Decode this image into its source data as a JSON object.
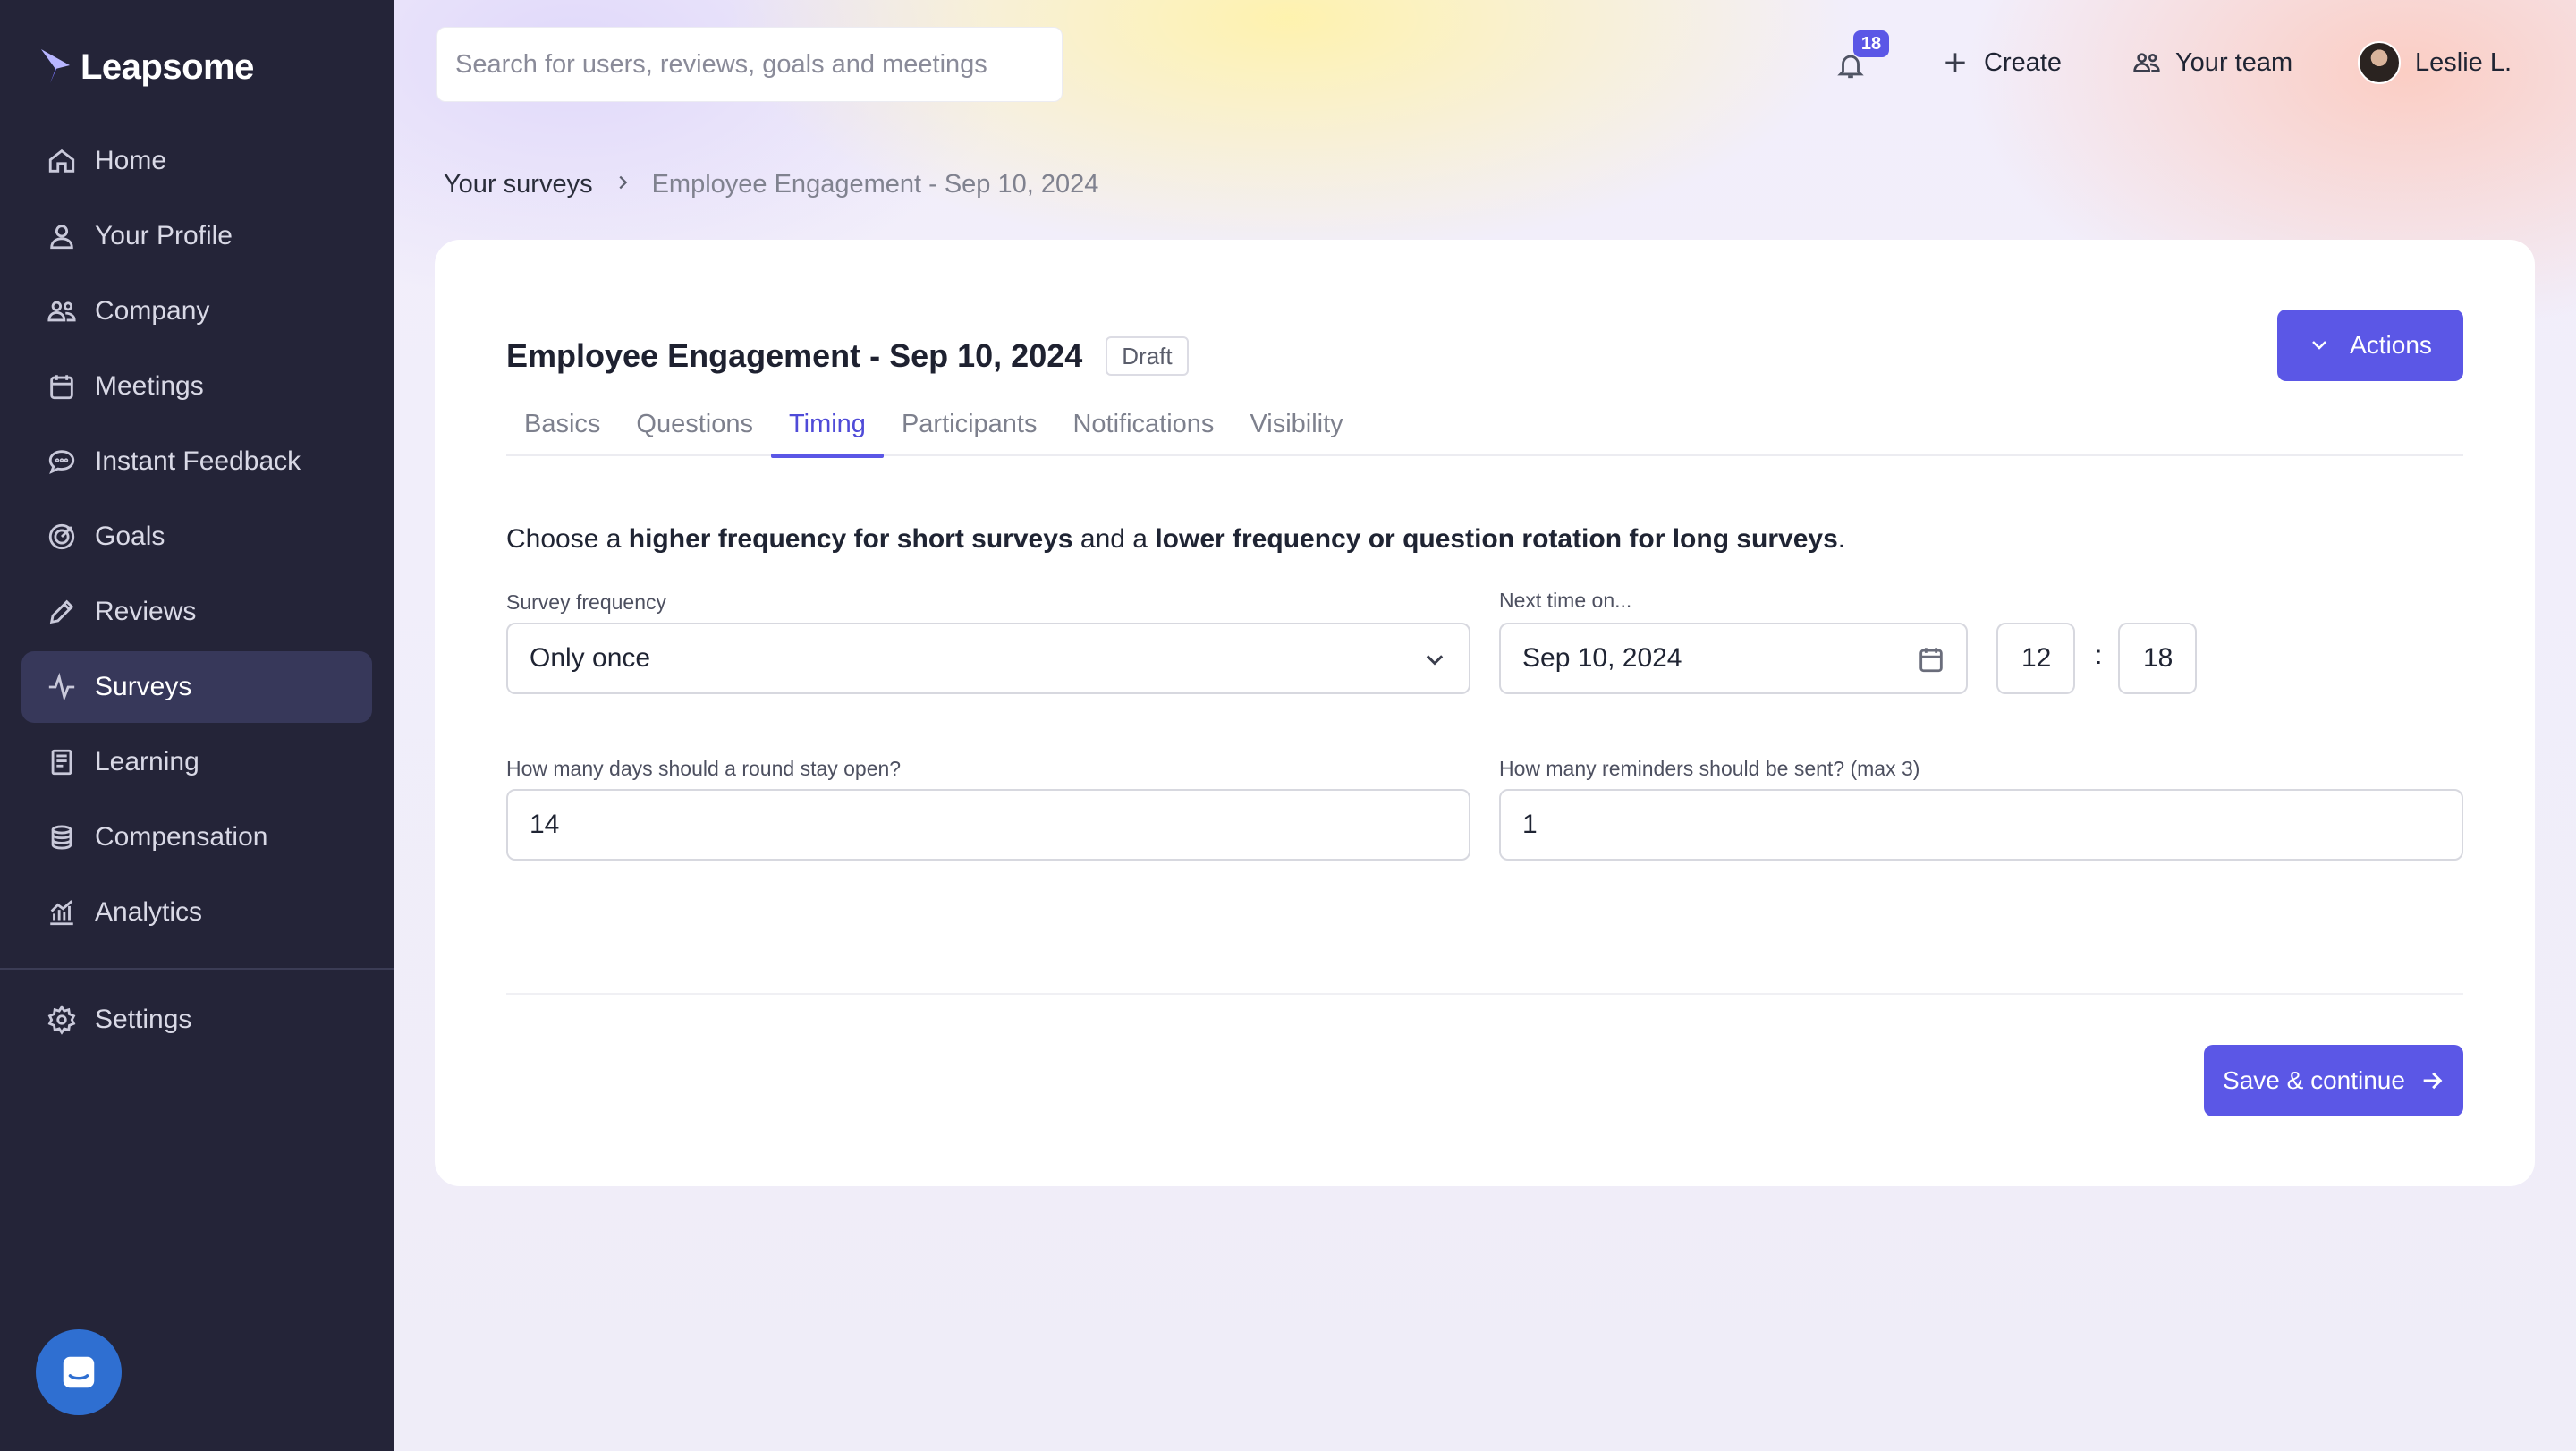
{
  "app": {
    "name": "Leapsome"
  },
  "sidebar": {
    "items": [
      {
        "label": "Home",
        "icon": "home-icon"
      },
      {
        "label": "Your Profile",
        "icon": "user-icon"
      },
      {
        "label": "Company",
        "icon": "users-icon"
      },
      {
        "label": "Meetings",
        "icon": "calendar-icon"
      },
      {
        "label": "Instant Feedback",
        "icon": "chat-icon"
      },
      {
        "label": "Goals",
        "icon": "target-icon"
      },
      {
        "label": "Reviews",
        "icon": "pencil-icon"
      },
      {
        "label": "Surveys",
        "icon": "pulse-icon",
        "active": true
      },
      {
        "label": "Learning",
        "icon": "book-icon"
      },
      {
        "label": "Compensation",
        "icon": "coins-icon"
      },
      {
        "label": "Analytics",
        "icon": "bar-chart-icon"
      }
    ],
    "settings": {
      "label": "Settings",
      "icon": "gear-icon"
    }
  },
  "header": {
    "search_placeholder": "Search for users, reviews, goals and meetings",
    "notifications_count": "18",
    "create_label": "Create",
    "team_label": "Your team",
    "user_name": "Leslie L."
  },
  "breadcrumb": {
    "parent": "Your surveys",
    "current": "Employee Engagement - Sep 10, 2024"
  },
  "survey": {
    "title": "Employee Engagement - Sep 10, 2024",
    "status": "Draft",
    "actions_label": "Actions",
    "tabs": [
      "Basics",
      "Questions",
      "Timing",
      "Participants",
      "Notifications",
      "Visibility"
    ],
    "active_tab": "Timing"
  },
  "timing": {
    "desc_1": "Choose a ",
    "desc_2": "higher frequency for short surveys",
    "desc_3": " and a ",
    "desc_4": "lower frequency or question rotation for long surveys",
    "desc_5": ".",
    "frequency_label": "Survey frequency",
    "frequency_value": "Only once",
    "next_time_label": "Next time on...",
    "next_date": "Sep 10, 2024",
    "hour": "12",
    "time_sep": ":",
    "minute": "18",
    "days_open_label": "How many days should a round stay open?",
    "days_open_value": "14",
    "reminders_label": "How many reminders should be sent? (max 3)",
    "reminders_value": "1",
    "save_label": "Save & continue"
  },
  "colors": {
    "sidebar_bg": "#242438",
    "accent": "#5b57e6",
    "active_tab": "#4f4bd8"
  }
}
